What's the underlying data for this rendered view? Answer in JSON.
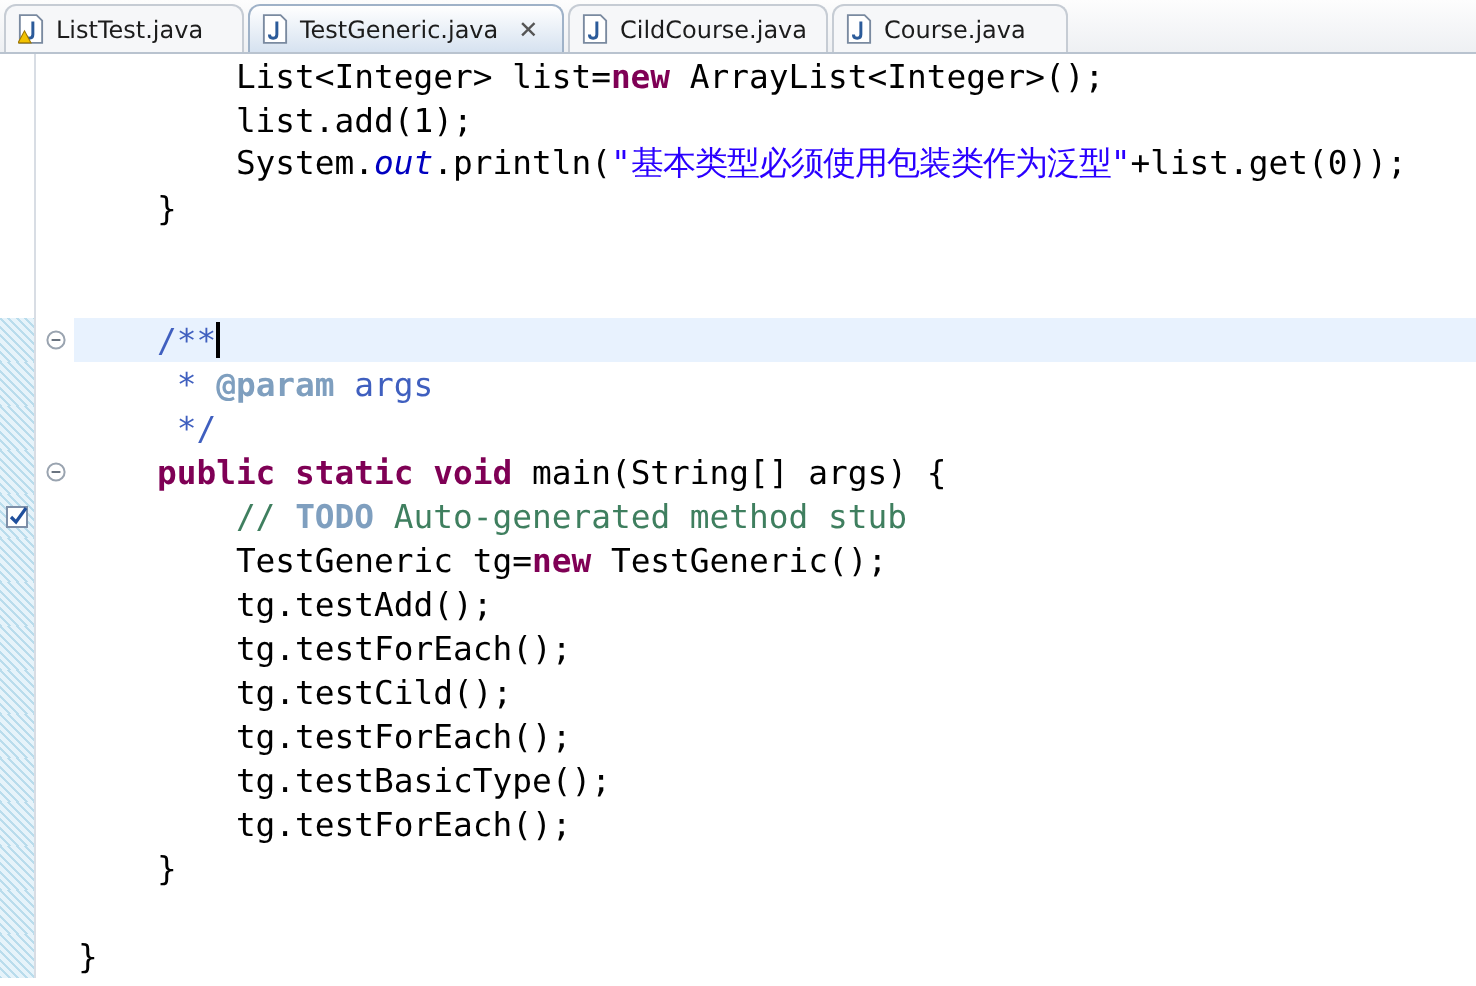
{
  "tabs": [
    {
      "label": "ListTest.java",
      "selected": false,
      "warning": true
    },
    {
      "label": "TestGeneric.java",
      "selected": true,
      "warning": false,
      "close": "✕"
    },
    {
      "label": "CildCourse.java",
      "selected": false,
      "warning": false
    },
    {
      "label": "Course.java",
      "selected": false,
      "warning": false
    }
  ],
  "lines": [
    {
      "tokens": [
        {
          "kind": "plain",
          "text": "        List<Integer> list="
        },
        {
          "kind": "keyword",
          "text": "new"
        },
        {
          "kind": "plain",
          "text": " ArrayList<Integer>();"
        }
      ]
    },
    {
      "tokens": [
        {
          "kind": "plain",
          "text": "        list.add(1);"
        }
      ]
    },
    {
      "tokens": [
        {
          "kind": "plain",
          "text": "        System."
        },
        {
          "kind": "field",
          "text": "out"
        },
        {
          "kind": "plain",
          "text": ".println("
        },
        {
          "kind": "string",
          "text": "\"基本类型必须使用包装类作为泛型\""
        },
        {
          "kind": "plain",
          "text": "+list.get(0));"
        }
      ]
    },
    {
      "tokens": [
        {
          "kind": "plain",
          "text": "    }"
        }
      ]
    },
    {
      "changed": false
    },
    {
      "changed": false
    },
    {
      "current": true,
      "changed": true,
      "expanded": true,
      "tokens": [
        {
          "kind": "javadoc",
          "text": "    /**"
        }
      ]
    },
    {
      "changed": true,
      "tokens": [
        {
          "kind": "javadoc",
          "text": "     * "
        },
        {
          "kind": "doctag",
          "text": "@param"
        },
        {
          "kind": "javadoc",
          "text": " args"
        }
      ]
    },
    {
      "changed": true,
      "tokens": [
        {
          "kind": "javadoc",
          "text": "     */"
        }
      ]
    },
    {
      "changed": true,
      "expanded": true,
      "tokens": [
        {
          "kind": "keyword",
          "text": "    public static void"
        },
        {
          "kind": "plain",
          "text": " main(String[] args) {"
        }
      ]
    },
    {
      "changed": true,
      "task": true,
      "tokens": [
        {
          "kind": "comment",
          "text": "        // "
        },
        {
          "kind": "todo",
          "text": "TODO"
        },
        {
          "kind": "comment",
          "text": " Auto-generated method stub"
        }
      ]
    },
    {
      "changed": true,
      "tokens": [
        {
          "kind": "plain",
          "text": "        TestGeneric tg="
        },
        {
          "kind": "keyword",
          "text": "new"
        },
        {
          "kind": "plain",
          "text": " TestGeneric();"
        }
      ]
    },
    {
      "changed": true,
      "tokens": [
        {
          "kind": "plain",
          "text": "        tg.testAdd();"
        }
      ]
    },
    {
      "changed": true,
      "tokens": [
        {
          "kind": "plain",
          "text": "        tg.testForEach();"
        }
      ]
    },
    {
      "changed": true,
      "tokens": [
        {
          "kind": "plain",
          "text": "        tg.testCild();"
        }
      ]
    },
    {
      "changed": true,
      "tokens": [
        {
          "kind": "plain",
          "text": "        tg.testForEach();"
        }
      ]
    },
    {
      "changed": true,
      "tokens": [
        {
          "kind": "plain",
          "text": "        tg.testBasicType();"
        }
      ]
    },
    {
      "changed": true,
      "tokens": [
        {
          "kind": "plain",
          "text": "        tg.testForEach();"
        }
      ]
    },
    {
      "changed": true,
      "tokens": [
        {
          "kind": "plain",
          "text": "    }"
        }
      ]
    },
    {
      "changed": true
    },
    {
      "changed": true,
      "tokens": [
        {
          "kind": "plain",
          "text": "}"
        }
      ]
    }
  ]
}
